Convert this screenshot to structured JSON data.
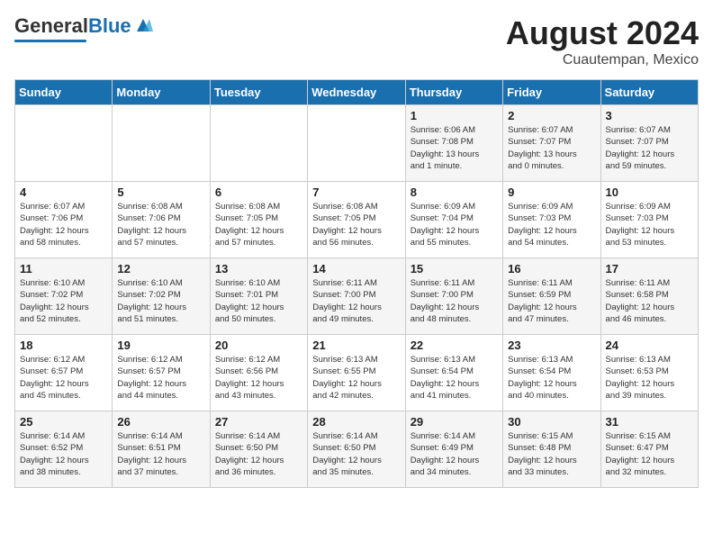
{
  "header": {
    "logo_general": "General",
    "logo_blue": "Blue",
    "month_title": "August 2024",
    "subtitle": "Cuautempan, Mexico"
  },
  "days_of_week": [
    "Sunday",
    "Monday",
    "Tuesday",
    "Wednesday",
    "Thursday",
    "Friday",
    "Saturday"
  ],
  "weeks": [
    [
      {
        "day": "",
        "info": ""
      },
      {
        "day": "",
        "info": ""
      },
      {
        "day": "",
        "info": ""
      },
      {
        "day": "",
        "info": ""
      },
      {
        "day": "1",
        "info": "Sunrise: 6:06 AM\nSunset: 7:08 PM\nDaylight: 13 hours\nand 1 minute."
      },
      {
        "day": "2",
        "info": "Sunrise: 6:07 AM\nSunset: 7:07 PM\nDaylight: 13 hours\nand 0 minutes."
      },
      {
        "day": "3",
        "info": "Sunrise: 6:07 AM\nSunset: 7:07 PM\nDaylight: 12 hours\nand 59 minutes."
      }
    ],
    [
      {
        "day": "4",
        "info": "Sunrise: 6:07 AM\nSunset: 7:06 PM\nDaylight: 12 hours\nand 58 minutes."
      },
      {
        "day": "5",
        "info": "Sunrise: 6:08 AM\nSunset: 7:06 PM\nDaylight: 12 hours\nand 57 minutes."
      },
      {
        "day": "6",
        "info": "Sunrise: 6:08 AM\nSunset: 7:05 PM\nDaylight: 12 hours\nand 57 minutes."
      },
      {
        "day": "7",
        "info": "Sunrise: 6:08 AM\nSunset: 7:05 PM\nDaylight: 12 hours\nand 56 minutes."
      },
      {
        "day": "8",
        "info": "Sunrise: 6:09 AM\nSunset: 7:04 PM\nDaylight: 12 hours\nand 55 minutes."
      },
      {
        "day": "9",
        "info": "Sunrise: 6:09 AM\nSunset: 7:03 PM\nDaylight: 12 hours\nand 54 minutes."
      },
      {
        "day": "10",
        "info": "Sunrise: 6:09 AM\nSunset: 7:03 PM\nDaylight: 12 hours\nand 53 minutes."
      }
    ],
    [
      {
        "day": "11",
        "info": "Sunrise: 6:10 AM\nSunset: 7:02 PM\nDaylight: 12 hours\nand 52 minutes."
      },
      {
        "day": "12",
        "info": "Sunrise: 6:10 AM\nSunset: 7:02 PM\nDaylight: 12 hours\nand 51 minutes."
      },
      {
        "day": "13",
        "info": "Sunrise: 6:10 AM\nSunset: 7:01 PM\nDaylight: 12 hours\nand 50 minutes."
      },
      {
        "day": "14",
        "info": "Sunrise: 6:11 AM\nSunset: 7:00 PM\nDaylight: 12 hours\nand 49 minutes."
      },
      {
        "day": "15",
        "info": "Sunrise: 6:11 AM\nSunset: 7:00 PM\nDaylight: 12 hours\nand 48 minutes."
      },
      {
        "day": "16",
        "info": "Sunrise: 6:11 AM\nSunset: 6:59 PM\nDaylight: 12 hours\nand 47 minutes."
      },
      {
        "day": "17",
        "info": "Sunrise: 6:11 AM\nSunset: 6:58 PM\nDaylight: 12 hours\nand 46 minutes."
      }
    ],
    [
      {
        "day": "18",
        "info": "Sunrise: 6:12 AM\nSunset: 6:57 PM\nDaylight: 12 hours\nand 45 minutes."
      },
      {
        "day": "19",
        "info": "Sunrise: 6:12 AM\nSunset: 6:57 PM\nDaylight: 12 hours\nand 44 minutes."
      },
      {
        "day": "20",
        "info": "Sunrise: 6:12 AM\nSunset: 6:56 PM\nDaylight: 12 hours\nand 43 minutes."
      },
      {
        "day": "21",
        "info": "Sunrise: 6:13 AM\nSunset: 6:55 PM\nDaylight: 12 hours\nand 42 minutes."
      },
      {
        "day": "22",
        "info": "Sunrise: 6:13 AM\nSunset: 6:54 PM\nDaylight: 12 hours\nand 41 minutes."
      },
      {
        "day": "23",
        "info": "Sunrise: 6:13 AM\nSunset: 6:54 PM\nDaylight: 12 hours\nand 40 minutes."
      },
      {
        "day": "24",
        "info": "Sunrise: 6:13 AM\nSunset: 6:53 PM\nDaylight: 12 hours\nand 39 minutes."
      }
    ],
    [
      {
        "day": "25",
        "info": "Sunrise: 6:14 AM\nSunset: 6:52 PM\nDaylight: 12 hours\nand 38 minutes."
      },
      {
        "day": "26",
        "info": "Sunrise: 6:14 AM\nSunset: 6:51 PM\nDaylight: 12 hours\nand 37 minutes."
      },
      {
        "day": "27",
        "info": "Sunrise: 6:14 AM\nSunset: 6:50 PM\nDaylight: 12 hours\nand 36 minutes."
      },
      {
        "day": "28",
        "info": "Sunrise: 6:14 AM\nSunset: 6:50 PM\nDaylight: 12 hours\nand 35 minutes."
      },
      {
        "day": "29",
        "info": "Sunrise: 6:14 AM\nSunset: 6:49 PM\nDaylight: 12 hours\nand 34 minutes."
      },
      {
        "day": "30",
        "info": "Sunrise: 6:15 AM\nSunset: 6:48 PM\nDaylight: 12 hours\nand 33 minutes."
      },
      {
        "day": "31",
        "info": "Sunrise: 6:15 AM\nSunset: 6:47 PM\nDaylight: 12 hours\nand 32 minutes."
      }
    ]
  ]
}
